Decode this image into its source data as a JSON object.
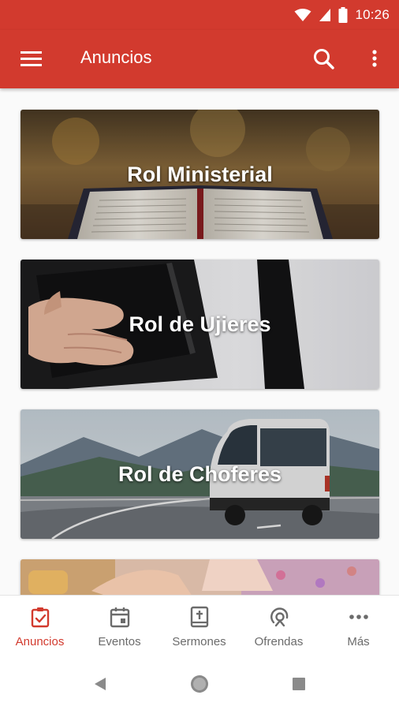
{
  "status_bar": {
    "time": "10:26"
  },
  "app_bar": {
    "title": "Anuncios"
  },
  "cards": [
    {
      "title": "Rol Ministerial"
    },
    {
      "title": "Rol de Ujieres"
    },
    {
      "title": "Rol de Choferes"
    },
    {
      "title": ""
    }
  ],
  "bottom_nav": {
    "items": [
      {
        "label": "Anuncios",
        "icon": "announcement-check-icon",
        "active": true
      },
      {
        "label": "Eventos",
        "icon": "calendar-icon",
        "active": false
      },
      {
        "label": "Sermones",
        "icon": "bible-icon",
        "active": false
      },
      {
        "label": "Ofrendas",
        "icon": "offering-icon",
        "active": false
      },
      {
        "label": "Más",
        "icon": "more-horizontal-icon",
        "active": false
      }
    ]
  },
  "colors": {
    "primary": "#d23a2e",
    "inactive": "#6b6b6b"
  }
}
